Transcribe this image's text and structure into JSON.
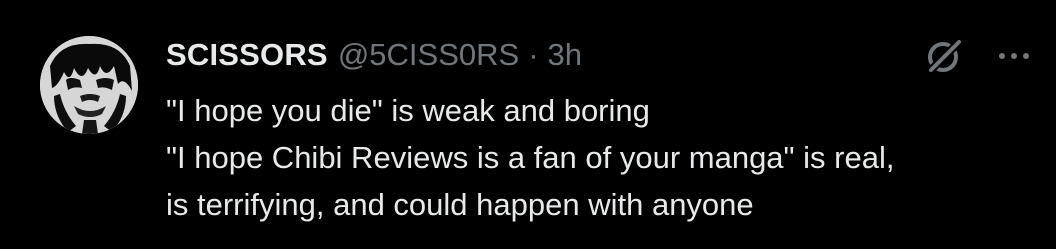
{
  "tweet": {
    "author": {
      "display_name": "SCISSORS",
      "handle": "@5CISS0RS"
    },
    "separator": "·",
    "time": "3h",
    "text_lines": [
      "\"I hope you die\" is weak and boring",
      "\"I hope Chibi Reviews is a fan of your manga\" is real,",
      "is terrifying, and could happen with anyone"
    ],
    "icons": {
      "grok": "grok-icon",
      "more": "more-options-icon"
    }
  }
}
